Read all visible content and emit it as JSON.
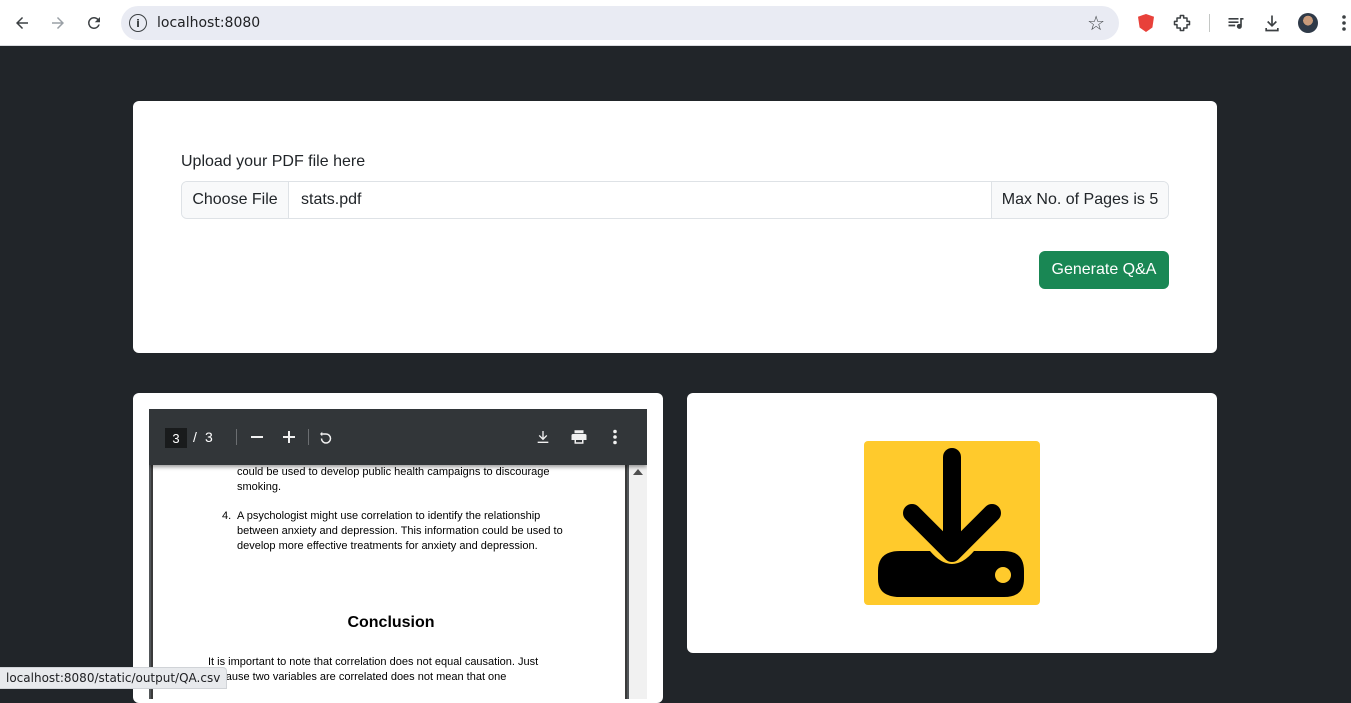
{
  "browser": {
    "url": "localhost:8080"
  },
  "upload": {
    "label": "Upload your PDF file here",
    "choose_button": "Choose File",
    "file_name": "stats.pdf",
    "max_pages": "Max No. of Pages is 5",
    "generate_button": "Generate Q&A"
  },
  "pdf_viewer": {
    "current_page": "3",
    "separator": "/",
    "total_pages": "3",
    "lines": {
      "l1": "could be used to develop public health campaigns to discourage",
      "l2": "smoking.",
      "item_number": "4.",
      "l3": "A psychologist might use correlation to identify the relationship",
      "l4": "between anxiety and depression. This information could be used to",
      "l5": "develop more effective treatments for anxiety and depression.",
      "heading": "Conclusion",
      "l6": "It is important to note that correlation does not equal causation. Just",
      "l7": "because two variables are correlated does not mean that one"
    }
  },
  "download": {
    "icon": "download-icon",
    "color": "#ffca2c"
  },
  "status_bar": {
    "text": "localhost:8080/static/output/QA.csv"
  },
  "colors": {
    "page_bg": "#212529",
    "button_success": "#198754"
  }
}
